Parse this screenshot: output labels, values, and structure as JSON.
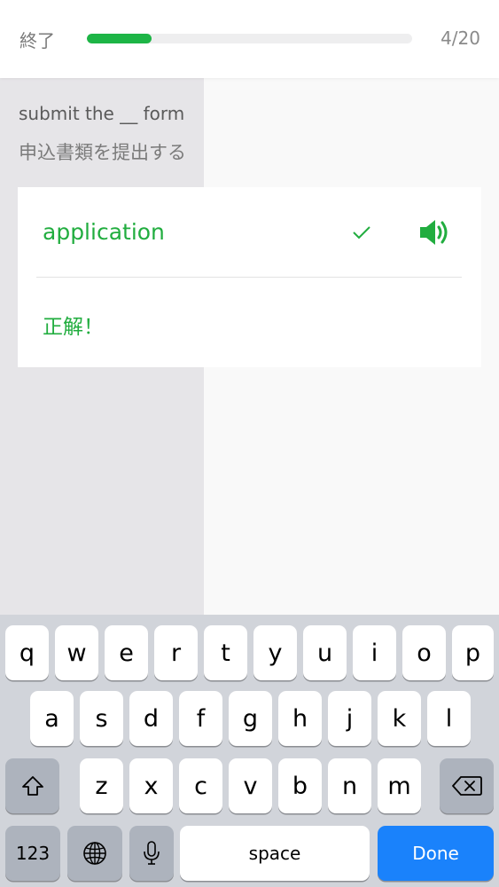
{
  "header": {
    "quit_label": "終了",
    "progress_count": "4/20",
    "progress_fraction": 0.2,
    "accent_color": "#1db546"
  },
  "question": {
    "sentence_en": "submit the __ form",
    "sentence_ja": "申込書類を提出する"
  },
  "answer": {
    "text": "application",
    "result": "正解！",
    "check_icon": "check-icon",
    "speaker_icon": "speaker-icon",
    "correct_color": "#21ad3f"
  },
  "keyboard": {
    "row1": [
      "q",
      "w",
      "e",
      "r",
      "t",
      "y",
      "u",
      "i",
      "o",
      "p"
    ],
    "row2": [
      "a",
      "s",
      "d",
      "f",
      "g",
      "h",
      "j",
      "k",
      "l"
    ],
    "row3": [
      "z",
      "x",
      "c",
      "v",
      "b",
      "n",
      "m"
    ],
    "numbers_label": "123",
    "space_label": "space",
    "done_label": "Done",
    "shift_icon": "shift-icon",
    "backspace_icon": "backspace-icon",
    "globe_icon": "globe-icon",
    "mic_icon": "microphone-icon",
    "done_color": "#1a82fb"
  }
}
